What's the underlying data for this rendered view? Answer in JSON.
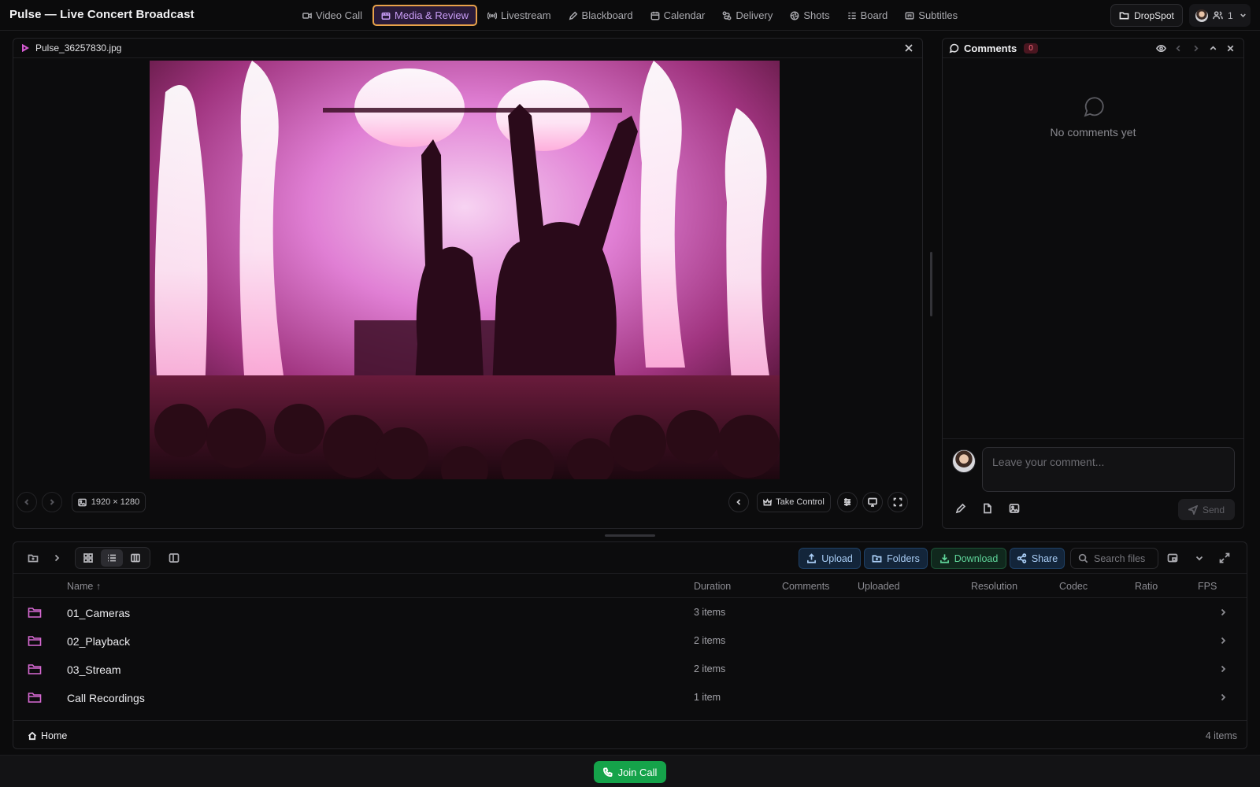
{
  "app": {
    "title": "Pulse — Live Concert Broadcast"
  },
  "nav": {
    "items": [
      {
        "label": "Video Call",
        "icon": "video-icon"
      },
      {
        "label": "Media & Review",
        "icon": "media-icon",
        "active": true
      },
      {
        "label": "Livestream",
        "icon": "broadcast-icon"
      },
      {
        "label": "Blackboard",
        "icon": "pen-icon"
      },
      {
        "label": "Calendar",
        "icon": "calendar-icon"
      },
      {
        "label": "Delivery",
        "icon": "route-icon"
      },
      {
        "label": "Shots",
        "icon": "aperture-icon"
      },
      {
        "label": "Board",
        "icon": "list-icon"
      },
      {
        "label": "Subtitles",
        "icon": "subtitles-icon"
      }
    ]
  },
  "header": {
    "dropspot_label": "DropSpot",
    "user_count": "1"
  },
  "viewer": {
    "file_name": "Pulse_36257830.jpg",
    "resolution": "1920 × 1280",
    "take_control_label": "Take Control"
  },
  "comments": {
    "title": "Comments",
    "count": "0",
    "empty_text": "No comments yet",
    "input_placeholder": "Leave your comment...",
    "send_label": "Send"
  },
  "files": {
    "actions": {
      "upload": "Upload",
      "folders": "Folders",
      "download": "Download",
      "share": "Share"
    },
    "search_placeholder": "Search files",
    "columns": [
      "Name ↑",
      "Duration",
      "Comments",
      "Uploaded",
      "Resolution",
      "Codec",
      "Ratio",
      "FPS"
    ],
    "rows": [
      {
        "name": "01_Cameras",
        "duration": "3 items"
      },
      {
        "name": "02_Playback",
        "duration": "2 items"
      },
      {
        "name": "03_Stream",
        "duration": "2 items"
      },
      {
        "name": "Call Recordings",
        "duration": "1 item"
      }
    ],
    "breadcrumb": "Home",
    "item_count": "4 items"
  },
  "footer": {
    "join_label": "Join Call"
  },
  "colors": {
    "accent_purple": "#c89cf5",
    "active_border": "#e8a24a",
    "join_green": "#15a34a",
    "folder_pink": "#d86ad3"
  }
}
